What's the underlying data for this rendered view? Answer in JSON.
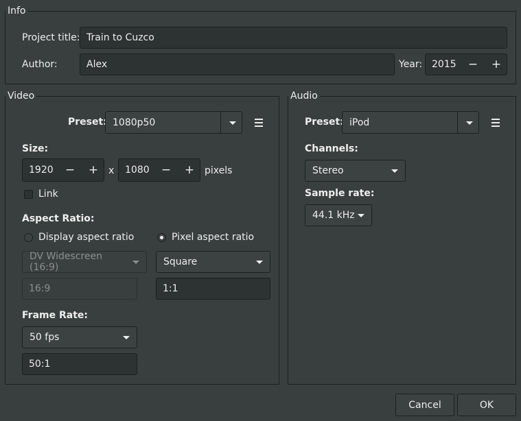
{
  "info": {
    "title": "Info",
    "project_title_label": "Project title:",
    "project_title_value": "Train to Cuzco",
    "author_label": "Author:",
    "author_value": "Alex",
    "year_label": "Year:",
    "year_value": "2015"
  },
  "video": {
    "title": "Video",
    "preset_label": "Preset:",
    "preset_value": "1080p50",
    "size_label": "Size:",
    "width_value": "1920",
    "height_value": "1080",
    "x_label": "x",
    "pixels_label": "pixels",
    "link_label": "Link",
    "aspect_label": "Aspect Ratio:",
    "display_aspect_label": "Display aspect ratio",
    "pixel_aspect_label": "Pixel aspect ratio",
    "display_aspect_value": "DV Widescreen (16:9)",
    "display_aspect_ratio": "16:9",
    "pixel_aspect_value": "Square",
    "pixel_aspect_ratio": "1:1",
    "frame_rate_label": "Frame Rate:",
    "frame_rate_value": "50 fps",
    "frame_rate_ratio": "50:1"
  },
  "audio": {
    "title": "Audio",
    "preset_label": "Preset:",
    "preset_value": "iPod",
    "channels_label": "Channels:",
    "channels_value": "Stereo",
    "sample_rate_label": "Sample rate:",
    "sample_rate_value": "44.1 kHz"
  },
  "spin": {
    "minus": "−",
    "plus": "+"
  },
  "buttons": {
    "cancel": "Cancel",
    "ok": "OK"
  },
  "colors": {
    "background": "#393f3f",
    "entry": "#2d3232",
    "border": "#1c1f1f",
    "text": "#eeeeec",
    "disabled_text": "#8b8e8f"
  }
}
